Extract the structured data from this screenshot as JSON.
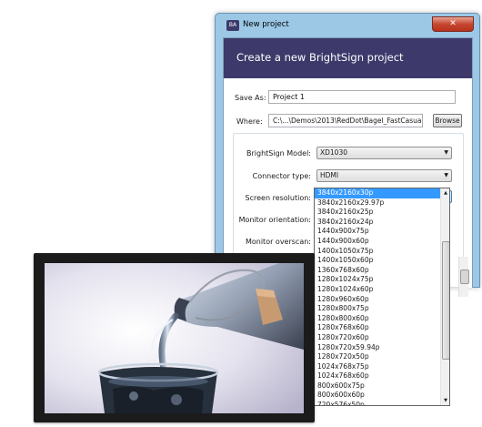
{
  "window": {
    "title": "New project",
    "app_icon": "BA",
    "close_glyph": "✕"
  },
  "banner": {
    "title": "Create a new BrightSign project"
  },
  "form": {
    "save_as_label": "Save As:",
    "save_as_value": "Project 1",
    "where_label": "Where:",
    "where_value": "C:\\...\\Demos\\2013\\RedDot\\Bagel_FastCasual",
    "browse_label": "Browse",
    "model_label": "BrightSign Model:",
    "model_value": "XD1030",
    "connector_label": "Connector type:",
    "connector_value": "HDMI",
    "resolution_label": "Screen resolution:",
    "resolution_value": "3840x2160x30p",
    "orientation_label": "Monitor orientation:",
    "overscan_label": "Monitor overscan:"
  },
  "dropdown": {
    "selected_index": 0,
    "items": [
      "3840x2160x30p",
      "3840x2160x29.97p",
      "3840x2160x25p",
      "3840x2160x24p",
      "1440x900x75p",
      "1440x900x60p",
      "1400x1050x75p",
      "1400x1050x60p",
      "1360x768x60p",
      "1280x1024x75p",
      "1280x1024x60p",
      "1280x960x60p",
      "1280x800x75p",
      "1280x800x60p",
      "1280x768x60p",
      "1280x720x60p",
      "1280x720x59.94p",
      "1280x720x50p",
      "1024x768x75p",
      "1024x768x60p",
      "800x600x75p",
      "800x600x60p",
      "720x576x50p"
    ]
  },
  "icons": {
    "combo_arrow": "▼",
    "scroll_up": "▲",
    "scroll_down": "▼",
    "scroll_grip": "≡"
  }
}
